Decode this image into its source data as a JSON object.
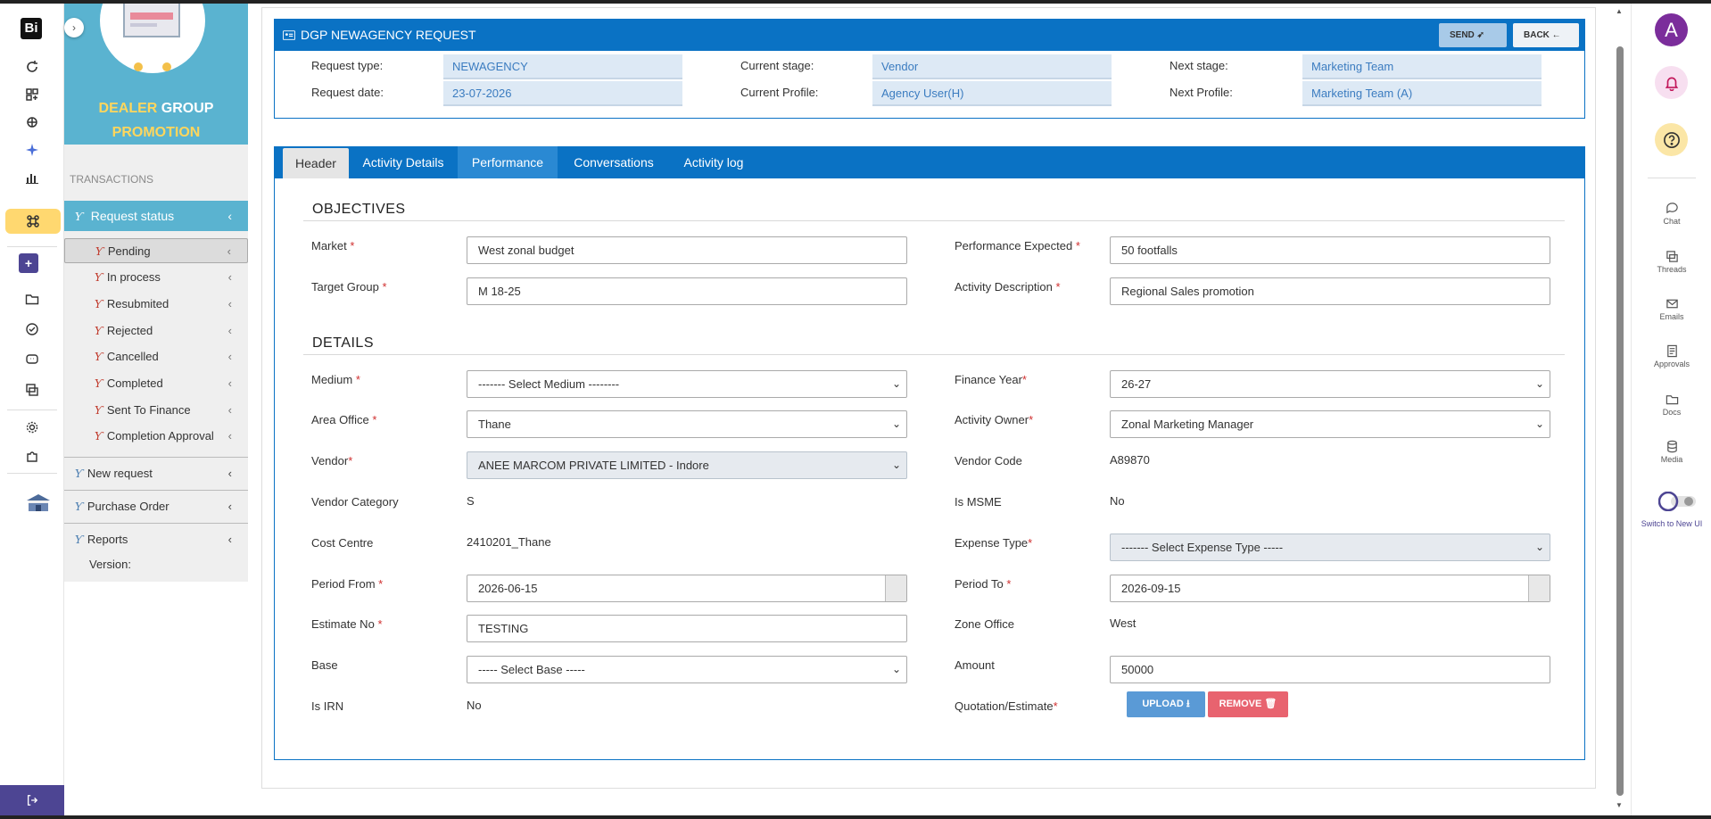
{
  "app": {
    "logo": "Bi"
  },
  "sidebar": {
    "banner": {
      "word1": "DEALER",
      "word2": "GROUP",
      "word3": "PROMOTION"
    },
    "section_label": "TRANSACTIONS",
    "request_status": "Request status",
    "items": [
      {
        "label": "Pending"
      },
      {
        "label": "In process"
      },
      {
        "label": "Resubmited"
      },
      {
        "label": "Rejected"
      },
      {
        "label": "Cancelled"
      },
      {
        "label": "Completed"
      },
      {
        "label": "Sent To Finance"
      },
      {
        "label": "Completion Approval"
      }
    ],
    "new_request": "New request",
    "purchase_order": "Purchase Order",
    "reports": "Reports",
    "version_label": "Version:"
  },
  "header": {
    "title": "DGP NEWAGENCY REQUEST",
    "send_label": "SEND",
    "back_label": "BACK"
  },
  "info": {
    "request_type_label": "Request type:",
    "request_type": "NEWAGENCY",
    "request_date_label": "Request date:",
    "request_date": "23-07-2026",
    "current_stage_label": "Current stage:",
    "current_stage": "Vendor",
    "current_profile_label": "Current Profile:",
    "current_profile": "Agency User(H)",
    "next_stage_label": "Next stage:",
    "next_stage": "Marketing Team",
    "next_profile_label": "Next Profile:",
    "next_profile": "Marketing Team (A)"
  },
  "tabs": [
    {
      "label": "Header"
    },
    {
      "label": "Activity Details"
    },
    {
      "label": "Performance"
    },
    {
      "label": "Conversations"
    },
    {
      "label": "Activity log"
    }
  ],
  "objectives": {
    "heading": "OBJECTIVES",
    "market_label": "Market",
    "market": "West zonal budget",
    "target_group_label": "Target Group",
    "target_group": "M 18-25",
    "performance_expected_label": "Performance Expected",
    "performance_expected": "50 footfalls",
    "activity_description_label": "Activity Description",
    "activity_description": "Regional Sales promotion"
  },
  "details": {
    "heading": "DETAILS",
    "medium_label": "Medium",
    "medium": "------- Select Medium --------",
    "area_office_label": "Area Office",
    "area_office": "Thane",
    "vendor_label": "Vendor",
    "vendor": "ANEE MARCOM PRIVATE LIMITED - Indore",
    "vendor_category_label": "Vendor Category",
    "vendor_category": "S",
    "cost_centre_label": "Cost Centre",
    "cost_centre": "2410201_Thane",
    "period_from_label": "Period From",
    "period_from": "2026-06-15",
    "estimate_no_label": "Estimate No",
    "estimate_no": "TESTING",
    "base_label": "Base",
    "base": "----- Select Base -----",
    "is_irn_label": "Is IRN",
    "is_irn": "No",
    "finance_year_label": "Finance Year",
    "finance_year": "26-27",
    "activity_owner_label": "Activity Owner",
    "activity_owner": "Zonal Marketing Manager",
    "vendor_code_label": "Vendor Code",
    "vendor_code": "A89870",
    "is_msme_label": "Is MSME",
    "is_msme": "No",
    "expense_type_label": "Expense Type",
    "expense_type": "------- Select Expense Type -----",
    "period_to_label": "Period To",
    "period_to": "2026-09-15",
    "zone_office_label": "Zone Office",
    "zone_office": "West",
    "amount_label": "Amount",
    "amount": "50000",
    "quotation_label": "Quotation/Estimate",
    "upload_label": "UPLOAD",
    "remove_label": "REMOVE"
  },
  "right_rail": {
    "avatar": "A",
    "items": [
      {
        "label": "Chat",
        "icon": "chat-icon"
      },
      {
        "label": "Threads",
        "icon": "threads-icon"
      },
      {
        "label": "Emails",
        "icon": "email-icon"
      },
      {
        "label": "Approvals",
        "icon": "approvals-icon"
      },
      {
        "label": "Docs",
        "icon": "folder-icon"
      },
      {
        "label": "Media",
        "icon": "database-icon"
      }
    ],
    "switch_label": "Switch to New UI"
  },
  "colors": {
    "primary_blue": "#0a72c4",
    "sidebar_teal": "#5ab3d0",
    "accent_purple": "#4d4593",
    "remove_red": "#e8636f",
    "upload_blue": "#5a9ad6"
  }
}
